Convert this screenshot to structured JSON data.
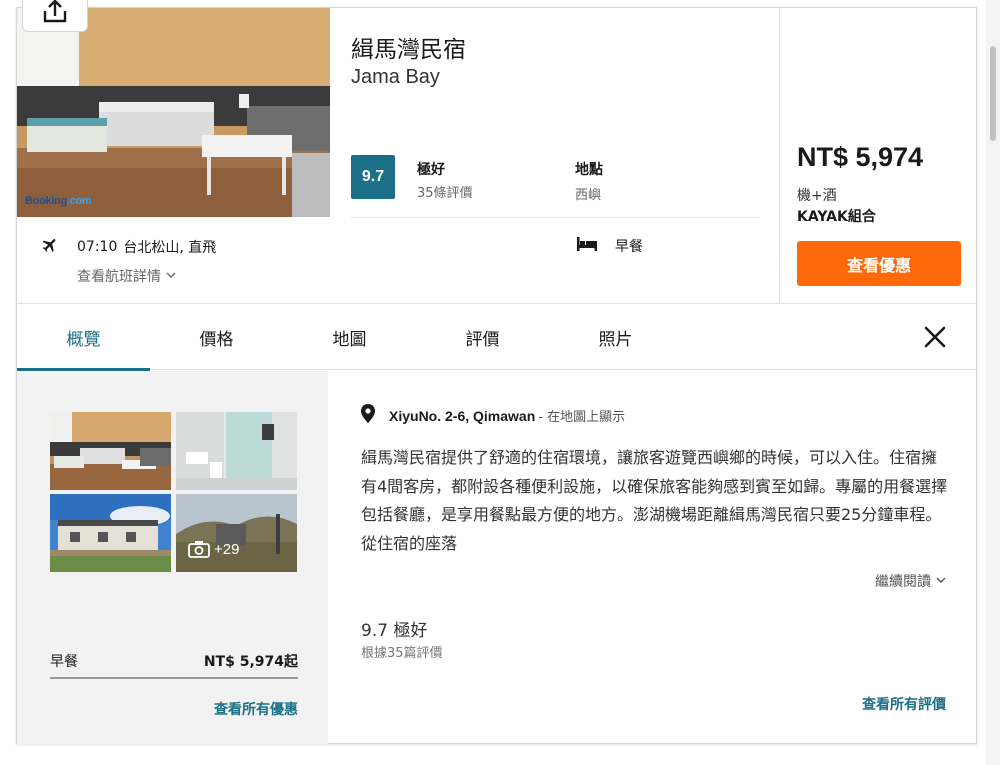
{
  "hotel": {
    "name_zh": "緝馬灣民宿",
    "name_en": "Jama Bay",
    "image_source": "Booking.com"
  },
  "rating": {
    "score": "9.7",
    "label": "極好",
    "count": "35條評價"
  },
  "location": {
    "label": "地點",
    "value": "西嶼"
  },
  "flight": {
    "time": "07:10",
    "route": "台北松山, 直飛",
    "details_link": "查看航班詳情"
  },
  "amenity": {
    "label": "早餐"
  },
  "pricing": {
    "price": "NT$ 5,974",
    "type": "機+酒",
    "provider": "KAYAK組合",
    "cta": "查看優惠"
  },
  "tabs": [
    {
      "label": "概覽",
      "active": true
    },
    {
      "label": "價格"
    },
    {
      "label": "地圖"
    },
    {
      "label": "評價"
    },
    {
      "label": "照片"
    }
  ],
  "gallery": {
    "more_count": "+29"
  },
  "offers": {
    "breakfast_label": "早餐",
    "breakfast_price": "NT$ 5,974起",
    "view_all": "查看所有優惠"
  },
  "address": {
    "text": "XiyuNo. 2-6, Qimawan",
    "map_link": "- 在地圖上顯示"
  },
  "description": "緝馬灣民宿提供了舒適的住宿環境，讓旅客遊覽西嶼鄉的時候，可以入住。住宿擁有4間客房，都附設各種便利設施，以確保旅客能夠感到賓至如歸。專屬的用餐選擇包括餐廳，是享用餐點最方便的地方。澎湖機場距離緝馬灣民宿只要25分鐘車程。 從住宿的座落",
  "read_more": "繼續閱讀",
  "review_summary": {
    "score_text": "9.7 極好",
    "based_on": "根據35篇評價",
    "view_all": "查看所有評價"
  },
  "colors": {
    "accent": "#1b6f87",
    "cta": "#ff6909"
  }
}
